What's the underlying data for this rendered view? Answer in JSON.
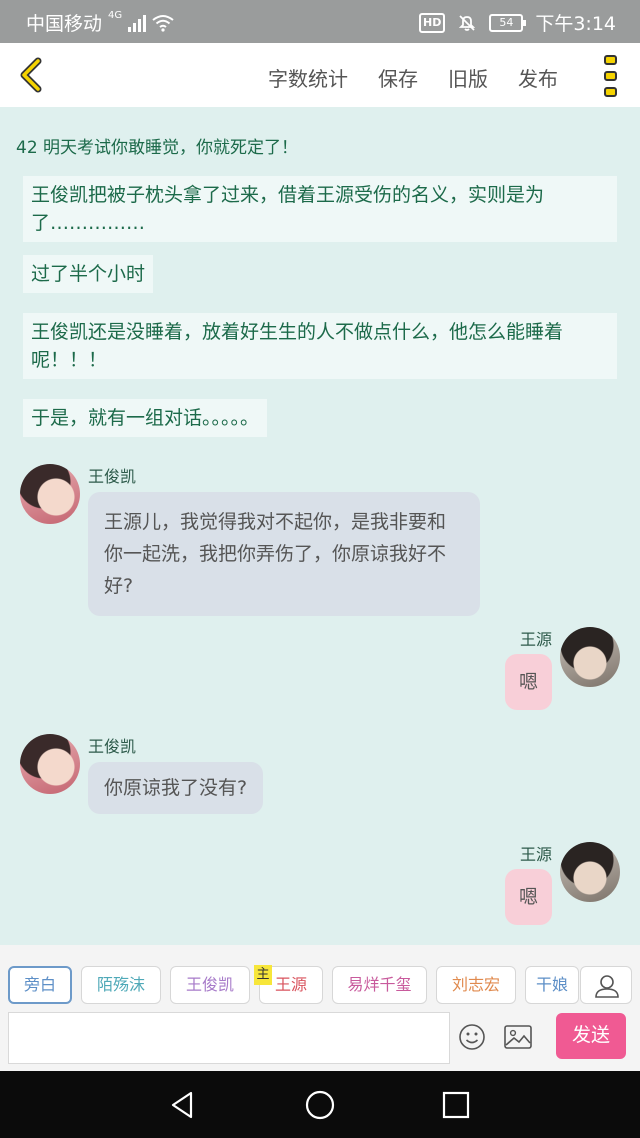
{
  "status_bar": {
    "carrier": "中国移动",
    "network": "4G",
    "hd": "HD",
    "battery": "54",
    "time": "下午3:14"
  },
  "toolbar": {
    "menu": [
      "字数统计",
      "保存",
      "旧版",
      "发布"
    ]
  },
  "chapter": {
    "title": "42 明天考试你敢睡觉，你就死定了！"
  },
  "narration": [
    "王俊凯把被子枕头拿了过来，借着王源受伤的名义，实则是为了……………",
    "过了半个小时",
    "王俊凯还是没睡着，放着好生生的人不做点什么，他怎么能睡着呢！！！",
    "于是，就有一组对话。。。。。"
  ],
  "messages": [
    {
      "speaker": "王俊凯",
      "text": "王源儿，我觉得我对不起你，是我非要和你一起洗，我把你弄伤了，你原谅我好不好?"
    },
    {
      "speaker": "王源",
      "text": "嗯"
    },
    {
      "speaker": "王俊凯",
      "text": "你原谅我了没有?"
    },
    {
      "speaker": "王源",
      "text": "嗯"
    }
  ],
  "roles": {
    "items": [
      "旁白",
      "陌殇沫",
      "王俊凯",
      "王源",
      "易烊千玺",
      "刘志宏",
      "干娘"
    ],
    "colors": [
      "#5d8fc7",
      "#4fa9b8",
      "#a77bc9",
      "#d9545e",
      "#c85a9c",
      "#e08a4e",
      "#5d8fc7"
    ],
    "main_badge": "主",
    "selected": "旁白"
  },
  "input": {
    "placeholder": "",
    "send_label": "发送"
  },
  "colors": {
    "background": "#dff0ee",
    "send": "#f05a93",
    "bubble_left": "#d9e0e8",
    "bubble_right": "#f8cfd8"
  }
}
